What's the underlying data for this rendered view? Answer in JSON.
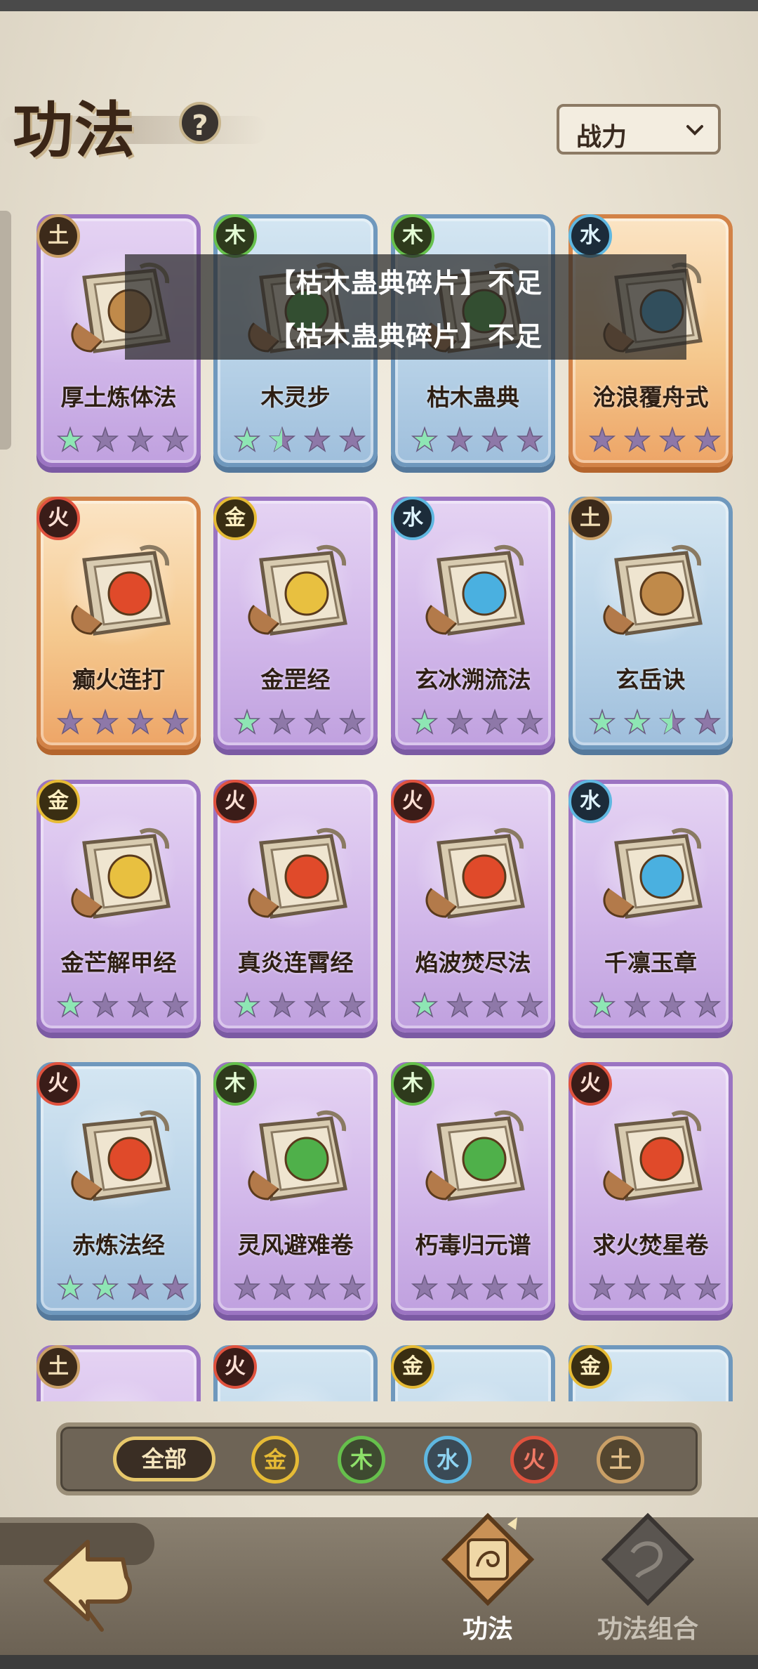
{
  "header": {
    "title": "功法",
    "help_label": "?",
    "sort_label": "战力"
  },
  "toast": {
    "messages": [
      "【枯木蛊典碎片】不足",
      "【枯木蛊典碎片】不足"
    ]
  },
  "cards": [
    {
      "name": "厚土炼体法",
      "element": "土",
      "rarity": "purple",
      "stars": 1,
      "half_star": false,
      "icon": "earth-shield-scroll-icon"
    },
    {
      "name": "木灵步",
      "element": "木",
      "rarity": "blue",
      "stars": 1,
      "half_star": true,
      "icon": "leaf-scroll-icon"
    },
    {
      "name": "枯木蛊典",
      "element": "木",
      "rarity": "blue",
      "stars": 1,
      "half_star": false,
      "icon": "poison-orb-scroll-icon"
    },
    {
      "name": "沧浪覆舟式",
      "element": "水",
      "rarity": "orange",
      "stars": 0,
      "half_star": false,
      "icon": "water-crystal-scroll-icon"
    },
    {
      "name": "癫火连打",
      "element": "火",
      "rarity": "orange",
      "stars": 0,
      "half_star": false,
      "icon": "fire-orb-scroll-icon"
    },
    {
      "name": "金罡经",
      "element": "金",
      "rarity": "purple",
      "stars": 1,
      "half_star": false,
      "icon": "golden-arrow-scroll-icon"
    },
    {
      "name": "玄冰溯流法",
      "element": "水",
      "rarity": "purple",
      "stars": 1,
      "half_star": false,
      "icon": "ice-wave-scroll-icon"
    },
    {
      "name": "玄岳诀",
      "element": "土",
      "rarity": "blue",
      "stars": 2,
      "half_star": true,
      "icon": "earth-book-icon"
    },
    {
      "name": "金芒解甲经",
      "element": "金",
      "rarity": "purple",
      "stars": 1,
      "half_star": false,
      "icon": "golden-sword-scroll-icon"
    },
    {
      "name": "真炎连霄经",
      "element": "火",
      "rarity": "purple",
      "stars": 1,
      "half_star": false,
      "icon": "flame-scroll-icon"
    },
    {
      "name": "焰波焚尽法",
      "element": "火",
      "rarity": "purple",
      "stars": 1,
      "half_star": false,
      "icon": "fire-wave-scroll-icon"
    },
    {
      "name": "千凛玉章",
      "element": "水",
      "rarity": "purple",
      "stars": 1,
      "half_star": false,
      "icon": "ice-shard-scroll-icon"
    },
    {
      "name": "赤炼法经",
      "element": "火",
      "rarity": "blue",
      "stars": 2,
      "half_star": false,
      "icon": "fire-book-icon"
    },
    {
      "name": "灵风避难卷",
      "element": "木",
      "rarity": "purple",
      "stars": 0,
      "half_star": false,
      "icon": "wind-leaf-scroll-icon"
    },
    {
      "name": "朽毒归元谱",
      "element": "木",
      "rarity": "purple",
      "stars": 0,
      "half_star": false,
      "icon": "poison-skull-scroll-icon"
    },
    {
      "name": "求火焚星卷",
      "element": "火",
      "rarity": "purple",
      "stars": 0,
      "half_star": false,
      "icon": "demon-fire-scroll-icon"
    },
    {
      "name": "",
      "element": "土",
      "rarity": "purple",
      "stars": 0,
      "half_star": false,
      "icon": ""
    },
    {
      "name": "",
      "element": "火",
      "rarity": "blue",
      "stars": 0,
      "half_star": false,
      "icon": ""
    },
    {
      "name": "",
      "element": "金",
      "rarity": "blue",
      "stars": 0,
      "half_star": false,
      "icon": ""
    },
    {
      "name": "",
      "element": "金",
      "rarity": "blue",
      "stars": 0,
      "half_star": false,
      "icon": ""
    }
  ],
  "filters": {
    "all_label": "全部",
    "elements": [
      "金",
      "木",
      "水",
      "火",
      "土"
    ]
  },
  "nav": {
    "tab_gongfa": "功法",
    "tab_combo": "功法组合"
  },
  "colors": {
    "tu": "#caa067",
    "mu": "#66c04c",
    "shui": "#5fb7e0",
    "huo": "#e0523e",
    "jin": "#e6bb35",
    "star_active": "#8ee6b4",
    "star_inactive": "#8e78a8"
  }
}
